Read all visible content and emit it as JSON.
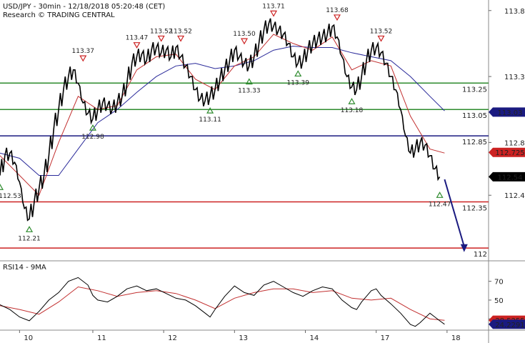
{
  "header": {
    "title": "USD/JPY - 30min - 12/18/2018 05:20:48 (CET)",
    "subtitle": "Research © TRADING CENTRAL"
  },
  "chart_data": [
    {
      "type": "line",
      "name": "price",
      "ylim": [
        111.93,
        113.88
      ],
      "xlim": [
        0,
        100
      ],
      "x_ticks": [
        {
          "label": "10",
          "x": 4
        },
        {
          "label": "11",
          "x": 19
        },
        {
          "label": "12",
          "x": 33.5
        },
        {
          "label": "13",
          "x": 48
        },
        {
          "label": "14",
          "x": 62.5
        },
        {
          "label": "17",
          "x": 77
        },
        {
          "label": "18",
          "x": 91.5
        }
      ],
      "y_ticks": [
        {
          "label": "113.8",
          "value": 113.8
        },
        {
          "label": "113.3",
          "value": 113.3
        },
        {
          "label": "112.8",
          "value": 112.8
        },
        {
          "label": "112.4",
          "value": 112.4
        }
      ],
      "price_path": [
        [
          0,
          112.55
        ],
        [
          1,
          112.7
        ],
        [
          2,
          112.72
        ],
        [
          3,
          112.65
        ],
        [
          4,
          112.5
        ],
        [
          5,
          112.3
        ],
        [
          6,
          112.22
        ],
        [
          7,
          112.35
        ],
        [
          8,
          112.45
        ],
        [
          9,
          112.55
        ],
        [
          10,
          112.7
        ],
        [
          11,
          112.9
        ],
        [
          12,
          113.05
        ],
        [
          13,
          113.2
        ],
        [
          14,
          113.3
        ],
        [
          15,
          113.35
        ],
        [
          16,
          113.25
        ],
        [
          17,
          113.1
        ],
        [
          18,
          113.02
        ],
        [
          19,
          112.98
        ],
        [
          20,
          113.05
        ],
        [
          21,
          113.1
        ],
        [
          22,
          113.08
        ],
        [
          23,
          113.05
        ],
        [
          24,
          113.1
        ],
        [
          25,
          113.15
        ],
        [
          26,
          113.25
        ],
        [
          27,
          113.4
        ],
        [
          28,
          113.45
        ],
        [
          29,
          113.47
        ],
        [
          30,
          113.42
        ],
        [
          31,
          113.5
        ],
        [
          32,
          113.52
        ],
        [
          33,
          113.48
        ],
        [
          34,
          113.5
        ],
        [
          35,
          113.45
        ],
        [
          36,
          113.52
        ],
        [
          37,
          113.45
        ],
        [
          38,
          113.38
        ],
        [
          39,
          113.3
        ],
        [
          40,
          113.2
        ],
        [
          41,
          113.13
        ],
        [
          42,
          113.12
        ],
        [
          43,
          113.15
        ],
        [
          44,
          113.2
        ],
        [
          45,
          113.28
        ],
        [
          46,
          113.35
        ],
        [
          47,
          113.42
        ],
        [
          48,
          113.5
        ],
        [
          49,
          113.45
        ],
        [
          50,
          113.4
        ],
        [
          51,
          113.38
        ],
        [
          52,
          113.45
        ],
        [
          53,
          113.55
        ],
        [
          54,
          113.65
        ],
        [
          55,
          113.7
        ],
        [
          56,
          113.68
        ],
        [
          57,
          113.65
        ],
        [
          58,
          113.62
        ],
        [
          59,
          113.55
        ],
        [
          60,
          113.45
        ],
        [
          61,
          113.4
        ],
        [
          62,
          113.42
        ],
        [
          63,
          113.5
        ],
        [
          64,
          113.55
        ],
        [
          65,
          113.58
        ],
        [
          66,
          113.6
        ],
        [
          67,
          113.62
        ],
        [
          68,
          113.68
        ],
        [
          69,
          113.6
        ],
        [
          70,
          113.45
        ],
        [
          71,
          113.3
        ],
        [
          72,
          113.22
        ],
        [
          73,
          113.2
        ],
        [
          74,
          113.3
        ],
        [
          75,
          113.42
        ],
        [
          76,
          113.5
        ],
        [
          77,
          113.52
        ],
        [
          78,
          113.48
        ],
        [
          79,
          113.4
        ],
        [
          80,
          113.3
        ],
        [
          81,
          113.2
        ],
        [
          82,
          113.05
        ],
        [
          83,
          112.85
        ],
        [
          84,
          112.72
        ],
        [
          85,
          112.75
        ],
        [
          86,
          112.8
        ],
        [
          87,
          112.78
        ],
        [
          88,
          112.7
        ],
        [
          89,
          112.6
        ],
        [
          90,
          112.54
        ]
      ],
      "ma_fast": [
        [
          0,
          112.7
        ],
        [
          4,
          112.55
        ],
        [
          8,
          112.4
        ],
        [
          12,
          112.8
        ],
        [
          16,
          113.15
        ],
        [
          20,
          113.05
        ],
        [
          24,
          113.08
        ],
        [
          28,
          113.35
        ],
        [
          32,
          113.45
        ],
        [
          36,
          113.47
        ],
        [
          40,
          113.28
        ],
        [
          44,
          113.2
        ],
        [
          48,
          113.38
        ],
        [
          52,
          113.45
        ],
        [
          56,
          113.62
        ],
        [
          60,
          113.55
        ],
        [
          64,
          113.5
        ],
        [
          68,
          113.6
        ],
        [
          72,
          113.35
        ],
        [
          76,
          113.42
        ],
        [
          80,
          113.38
        ],
        [
          84,
          113.0
        ],
        [
          88,
          112.75
        ],
        [
          91,
          112.72
        ]
      ],
      "ma_slow": [
        [
          0,
          112.72
        ],
        [
          4,
          112.68
        ],
        [
          8,
          112.55
        ],
        [
          12,
          112.55
        ],
        [
          16,
          112.75
        ],
        [
          20,
          112.95
        ],
        [
          24,
          113.05
        ],
        [
          28,
          113.18
        ],
        [
          32,
          113.3
        ],
        [
          36,
          113.38
        ],
        [
          40,
          113.4
        ],
        [
          44,
          113.36
        ],
        [
          48,
          113.38
        ],
        [
          52,
          113.42
        ],
        [
          56,
          113.5
        ],
        [
          60,
          113.53
        ],
        [
          64,
          113.52
        ],
        [
          68,
          113.52
        ],
        [
          72,
          113.48
        ],
        [
          76,
          113.45
        ],
        [
          80,
          113.42
        ],
        [
          84,
          113.3
        ],
        [
          88,
          113.15
        ],
        [
          91,
          113.04
        ]
      ],
      "forecast_arrow": {
        "from": [
          91,
          112.52
        ],
        "to": [
          95,
          111.98
        ]
      },
      "levels": [
        {
          "value": 113.25,
          "label": "113.25",
          "color": "#2e8b2e"
        },
        {
          "value": 113.05,
          "label": "113.05",
          "color": "#2e8b2e"
        },
        {
          "value": 112.85,
          "label": "112.85",
          "color": "#1a1a80"
        },
        {
          "value": 112.35,
          "label": "112.35",
          "color": "#cc2222"
        },
        {
          "value": 112.0,
          "label": "112",
          "color": "#cc2222"
        }
      ],
      "badges": [
        {
          "label": "113.03",
          "value": 113.03,
          "color": "#1a1a80"
        },
        {
          "label": "112.725",
          "value": 112.725,
          "color": "#cc2222"
        },
        {
          "label": "112.54",
          "value": 112.54,
          "color": "#000000"
        }
      ],
      "annotations": [
        {
          "label": "113.37",
          "x": 17,
          "value": 113.37,
          "kind": "high"
        },
        {
          "label": "113.47",
          "x": 28,
          "value": 113.47,
          "kind": "high"
        },
        {
          "label": "113.52",
          "x": 33,
          "value": 113.52,
          "kind": "high"
        },
        {
          "label": "113.52",
          "x": 37,
          "value": 113.52,
          "kind": "high"
        },
        {
          "label": "113.50",
          "x": 50,
          "value": 113.5,
          "kind": "high"
        },
        {
          "label": "113.71",
          "x": 56,
          "value": 113.71,
          "kind": "high"
        },
        {
          "label": "113.68",
          "x": 69,
          "value": 113.68,
          "kind": "high"
        },
        {
          "label": "113.52",
          "x": 78,
          "value": 113.52,
          "kind": "high"
        },
        {
          "label": "112.53",
          "x": 0,
          "value": 112.53,
          "kind": "low"
        },
        {
          "label": "112.21",
          "x": 6,
          "value": 112.21,
          "kind": "low"
        },
        {
          "label": "112.98",
          "x": 19,
          "value": 112.98,
          "kind": "low"
        },
        {
          "label": "113.11",
          "x": 43,
          "value": 113.11,
          "kind": "low"
        },
        {
          "label": "113.33",
          "x": 51,
          "value": 113.33,
          "kind": "low"
        },
        {
          "label": "113.39",
          "x": 61,
          "value": 113.39,
          "kind": "low"
        },
        {
          "label": "113.18",
          "x": 72,
          "value": 113.18,
          "kind": "low"
        },
        {
          "label": "112.47",
          "x": 90,
          "value": 112.47,
          "kind": "low"
        }
      ]
    },
    {
      "type": "line",
      "name": "rsi",
      "title": "RSI14 - 9MA",
      "ylim": [
        18,
        88
      ],
      "y_ticks": [
        {
          "label": "70",
          "value": 70
        },
        {
          "label": "50",
          "value": 50
        },
        {
          "label": "30",
          "value": 30
        }
      ],
      "rsi": [
        [
          0,
          45
        ],
        [
          2,
          40
        ],
        [
          4,
          32
        ],
        [
          6,
          28
        ],
        [
          8,
          38
        ],
        [
          10,
          50
        ],
        [
          12,
          58
        ],
        [
          14,
          70
        ],
        [
          16,
          74
        ],
        [
          18,
          66
        ],
        [
          19,
          55
        ],
        [
          20,
          50
        ],
        [
          22,
          48
        ],
        [
          24,
          54
        ],
        [
          26,
          62
        ],
        [
          28,
          65
        ],
        [
          30,
          60
        ],
        [
          32,
          62
        ],
        [
          34,
          57
        ],
        [
          36,
          52
        ],
        [
          38,
          50
        ],
        [
          40,
          44
        ],
        [
          42,
          36
        ],
        [
          43,
          32
        ],
        [
          44,
          40
        ],
        [
          46,
          54
        ],
        [
          48,
          65
        ],
        [
          50,
          58
        ],
        [
          52,
          55
        ],
        [
          54,
          66
        ],
        [
          56,
          70
        ],
        [
          58,
          64
        ],
        [
          60,
          58
        ],
        [
          62,
          54
        ],
        [
          64,
          60
        ],
        [
          66,
          64
        ],
        [
          68,
          62
        ],
        [
          70,
          50
        ],
        [
          72,
          42
        ],
        [
          73,
          40
        ],
        [
          74,
          48
        ],
        [
          76,
          60
        ],
        [
          77,
          62
        ],
        [
          78,
          55
        ],
        [
          80,
          46
        ],
        [
          82,
          36
        ],
        [
          84,
          24
        ],
        [
          85,
          22
        ],
        [
          86,
          26
        ],
        [
          88,
          36
        ],
        [
          89,
          32
        ],
        [
          90,
          28
        ],
        [
          91,
          24.23
        ]
      ],
      "rsi_ma": [
        [
          0,
          44
        ],
        [
          4,
          40
        ],
        [
          8,
          35
        ],
        [
          12,
          48
        ],
        [
          16,
          64
        ],
        [
          20,
          60
        ],
        [
          24,
          54
        ],
        [
          28,
          58
        ],
        [
          32,
          60
        ],
        [
          36,
          57
        ],
        [
          40,
          50
        ],
        [
          44,
          41
        ],
        [
          48,
          52
        ],
        [
          52,
          58
        ],
        [
          56,
          62
        ],
        [
          60,
          62
        ],
        [
          64,
          58
        ],
        [
          68,
          60
        ],
        [
          72,
          52
        ],
        [
          76,
          50
        ],
        [
          80,
          52
        ],
        [
          84,
          40
        ],
        [
          88,
          30
        ],
        [
          91,
          28.53
        ]
      ],
      "badges": [
        {
          "label": "28.5255",
          "value": 28.53,
          "color": "#cc2222"
        },
        {
          "label": "24.2291",
          "value": 24.23,
          "color": "#1a1a80"
        }
      ]
    }
  ]
}
